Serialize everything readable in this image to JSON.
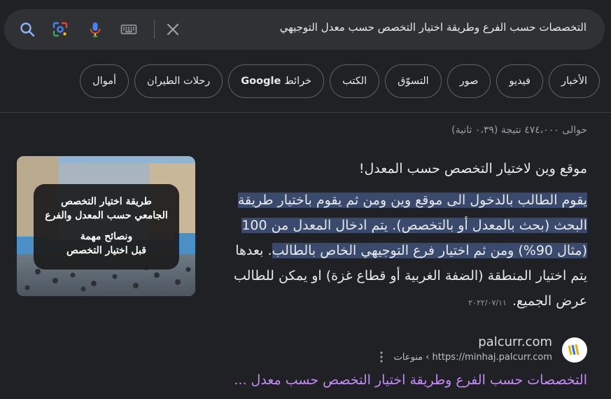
{
  "search": {
    "query": "التخصصات حسب الفرع وطريقة اختيار التخصص حسب معدل التوجيهي"
  },
  "search_icons": [
    "search-icon",
    "lens-icon",
    "microphone-icon",
    "keyboard-icon",
    "clear-icon"
  ],
  "chips": [
    {
      "name": "news",
      "label": "الأخبار"
    },
    {
      "name": "videos",
      "label": "فيديو"
    },
    {
      "name": "images",
      "label": "صور"
    },
    {
      "name": "shopping",
      "label": "التسوّق"
    },
    {
      "name": "books",
      "label": "الكتب"
    },
    {
      "name": "maps",
      "prefix": "Google",
      "label": "خرائط"
    },
    {
      "name": "flights",
      "label": "رحلات الطيران"
    },
    {
      "name": "finance",
      "label": "أموال"
    }
  ],
  "stats": "حوالى ٤٧٤،٠٠٠ نتيجة (٠،٣٩ ثانية)",
  "snippet": {
    "heading": "موقع وين لاختيار التخصص حسب المعدل!",
    "body_highlight": "يقوم الطالب بالدخول الى موقع وين ومن ثم يقوم باختيار طريقة البحث (بحث بالمعدل أو بالتخصص). يتم ادخال المعدل من 100 (مثال 90%) ومن ثم اختيار فرع التوجيهي الخاص بالطالب",
    "body_rest": ". بعدها يتم اختيار المنطقة (الضفة الغربية أو قطاع غزة) او يمكن للطالب عرض الجميع.",
    "date": "٢٠٢٢/٠٧/١١",
    "image_text": {
      "line1": "طريقة اختيار التخصص",
      "line2": "الجامعي حسب المعدل والفرع",
      "line3": "ونصائح مهمة",
      "line4": "قبل اختيار التخصص"
    }
  },
  "source": {
    "site_name": "palcurr.com",
    "url": "https://minhaj.palcurr.com › منوعات",
    "title": "التخصصات حسب الفرع وطريقة اختيار التخصص حسب معدل ..."
  },
  "colors": {
    "background": "#202124",
    "search_bar": "#303134",
    "highlight": "#3a4a6d",
    "visited_link": "#c58af9",
    "secondary_text": "#9aa0a6"
  }
}
